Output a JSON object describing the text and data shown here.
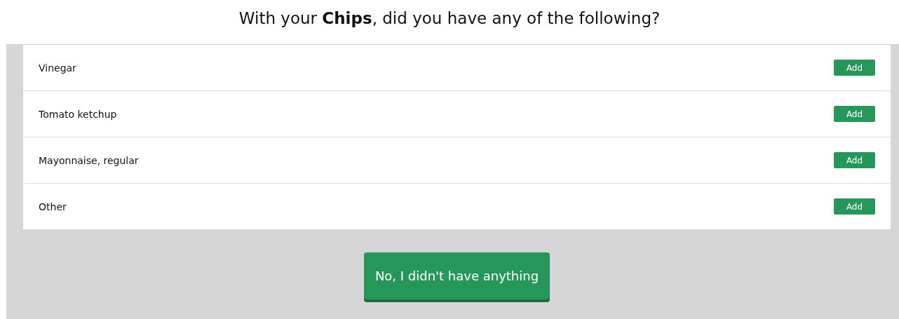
{
  "question": "With your **Chips**, did you have any of the following?",
  "options": [
    {
      "label": "Vinegar",
      "button": "Add"
    },
    {
      "label": "Tomato ketchup",
      "button": "Add"
    },
    {
      "label": "Mayonnaise, regular",
      "button": "Add"
    },
    {
      "label": "Other",
      "button": "Add"
    }
  ],
  "none_button": "No, I didn't have anything"
}
